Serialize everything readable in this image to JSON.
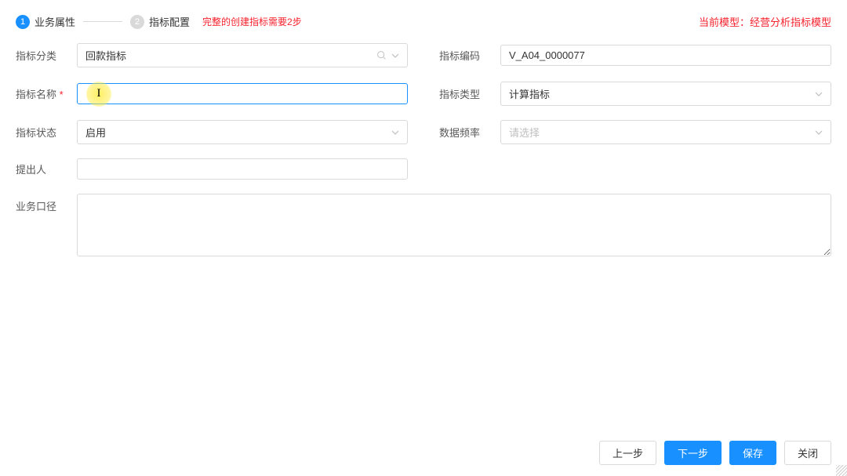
{
  "header": {
    "step1_num": "1",
    "step1_label": "业务属性",
    "step2_num": "2",
    "step2_label": "指标配置",
    "hint": "完整的创建指标需要2步",
    "model_prefix": "当前模型：",
    "model_name": "经营分析指标模型"
  },
  "form": {
    "category": {
      "label": "指标分类",
      "value": "回款指标"
    },
    "code": {
      "label": "指标编码",
      "value": "V_A04_0000077"
    },
    "name": {
      "label": "指标名称",
      "value": ""
    },
    "type": {
      "label": "指标类型",
      "value": "计算指标"
    },
    "status": {
      "label": "指标状态",
      "value": "启用"
    },
    "frequency": {
      "label": "数据频率",
      "placeholder": "请选择"
    },
    "proposer": {
      "label": "提出人",
      "value": ""
    },
    "caliber": {
      "label": "业务口径",
      "value": ""
    }
  },
  "footer": {
    "prev": "上一步",
    "next": "下一步",
    "save": "保存",
    "close": "关闭"
  }
}
